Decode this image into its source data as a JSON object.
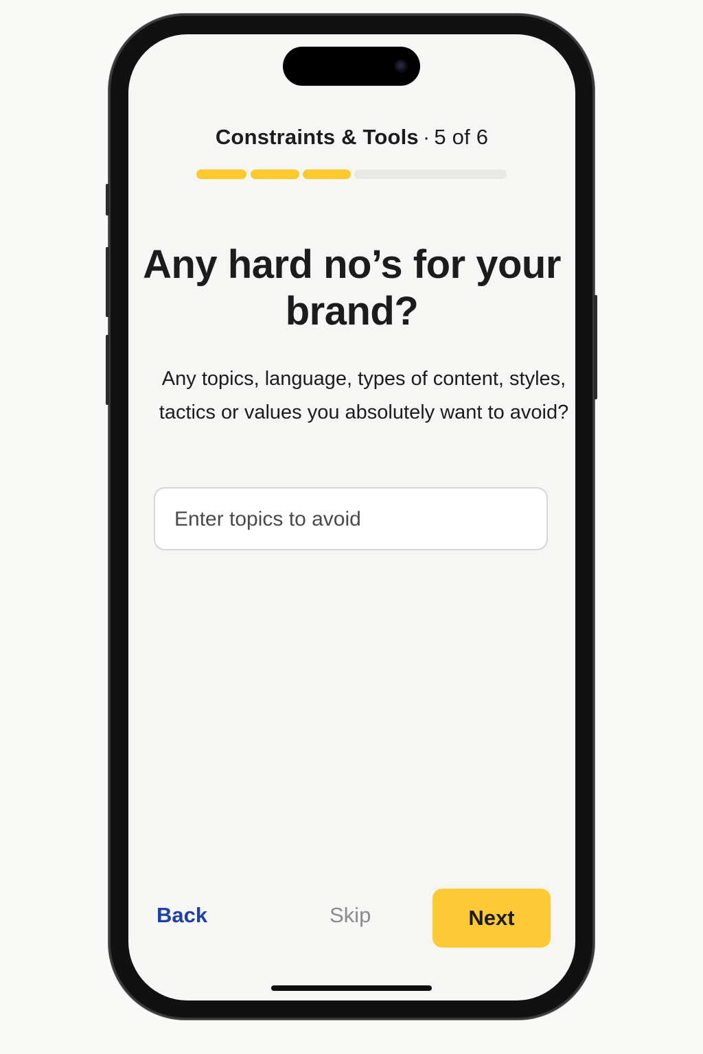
{
  "header": {
    "section_title": "Constraints & Tools",
    "separator": "·",
    "step_text": "5 of 6"
  },
  "progress": {
    "completed_segments": 3,
    "remaining_segments": 1,
    "accent_color": "#fcc92f",
    "track_color": "#e8e8e6"
  },
  "question": {
    "headline": "Any hard no’s for your brand?",
    "description": "Any topics, language, types of content, styles, tactics or values you absolutely want to avoid?"
  },
  "avoid_input": {
    "placeholder": "Enter topics to avoid",
    "value": ""
  },
  "footer": {
    "back_label": "Back",
    "skip_label": "Skip",
    "next_label": "Next",
    "back_color": "#1f3fa8",
    "next_color": "#fdc935"
  }
}
